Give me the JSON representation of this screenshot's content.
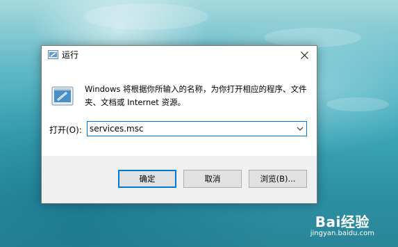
{
  "dialog": {
    "title": "运行",
    "description": "Windows 将根据你所输入的名称，为你打开相应的程序、文件夹、文档或 Internet 资源。",
    "open_label": "打开(O):",
    "input_value": "services.msc",
    "buttons": {
      "ok": "确定",
      "cancel": "取消",
      "browse": "浏览(B)..."
    },
    "accent_color": "#0078d7"
  },
  "watermark": {
    "logo": "Bai经验",
    "url": "jingyan.baidu.com"
  }
}
